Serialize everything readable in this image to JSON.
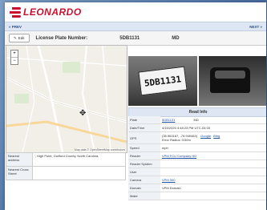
{
  "brand": {
    "name": "LEONARDO"
  },
  "nav": {
    "prev": "« PREV",
    "next": "NEXT »"
  },
  "header": {
    "edit_label": "Edit",
    "plate_label": "License Plate Number:",
    "plate_number": "5DB1131",
    "state": "MD"
  },
  "map": {
    "zoom_in": "+",
    "zoom_out": "−",
    "attribution": "Map data © OpenStreetMap contributors"
  },
  "address": {
    "nearest_label": "Nearest address",
    "nearest_value": "', High Point, Guilford County, North Carolina,",
    "cross_label": "Nearest Cross Street",
    "cross_value": ""
  },
  "plate_photo_text": "5DB1131",
  "read_info": {
    "title": "Read Info",
    "rows": [
      {
        "key": "Plate",
        "value": "5DB1131",
        "extra": "MD"
      },
      {
        "key": "Date/Time",
        "value": "4/15/2020 4:48:23 PM UTC-04:00"
      },
      {
        "key": "GPS",
        "value": "(35.963167, -79.949483)",
        "link1": "Google",
        "link2": "Bing",
        "note": "Error Radius: 0/30m"
      },
      {
        "key": "Speed",
        "value": "mph"
      },
      {
        "key": "Reader",
        "value": "VPM FCU Company HD"
      },
      {
        "key": "Reader System",
        "value": ""
      },
      {
        "key": "User",
        "value": ""
      },
      {
        "key": "Camera",
        "value": "VPM 300"
      },
      {
        "key": "Domain",
        "value": "VPM Domain"
      },
      {
        "key": "Make",
        "value": ""
      }
    ]
  }
}
